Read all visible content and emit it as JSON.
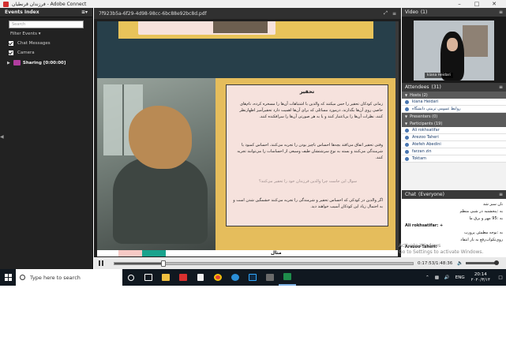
{
  "window": {
    "title": "فرزندان قرنطیان - Adobe Connect"
  },
  "events": {
    "title": "Events Index",
    "search_placeholder": "Search",
    "filter_label": "Filter Events",
    "checks": [
      "Chat Messages",
      "Camera"
    ],
    "sharing_label": "Sharing [0:00:00]"
  },
  "share": {
    "file_name": "7f923b5a-6f29-4d98-98cc-6bc88e92bc8d.pdf",
    "slide": {
      "title": "تحقیر",
      "paragraphs": [
        "زمانی کودکان تحقیر را حس میکنند که والدین با اشتباهات آن‌ها را مسخره کرده، نام‌های خاصی روی آن‌ها بگذارند، درمورد مسائلی که برای آن‌ها اهمیت دارد تحقیرآمیز اظهارنظر کنند، نظرات آن‌ها را بی‌اعتبار کنند و یا به هر صورتی آن‌ها را سرافکنده کنند.",
        "وقتی تحقیر اتفاق می‌افتد بچه‌ها احساس ناچیز بودن را تجربه می‌کنند، احساس کمبود یا شرمندگی می‌کنند و بسته به نوع سرشتشان طیف وسیعی از احساسات را می‌توانند تجربه کنند.",
        "سوال این جاست چرا والدین فرزندان خود را تحقیر می‌کنند؟",
        "اگر والدین در کودکی که احساس تحقیر و شرمندگی را تجربه می‌کنند خشمگین شدن است و به احتمال زیاد این کودکان آسیب خواهند دید."
      ],
      "next_word": "مثال"
    }
  },
  "playback": {
    "time": "0:17:53/1:48:36",
    "progress": 0.164
  },
  "video": {
    "title": "Video",
    "count": "(1)",
    "presenter_name": "kiana Heidari"
  },
  "attendees": {
    "title": "Attendees",
    "count": "(31)",
    "hosts_label": "Hosts (2)",
    "hosts": [
      "kiana Heidari",
      "روابط عمومی تربیتی دانشگاه"
    ],
    "presenters_label": "Presenters (0)",
    "participants_label": "Participants (19)",
    "participants": [
      "Ali rokhsatifar",
      "Arezoo Taheri",
      "Atefeh Abedini",
      "farzan zin",
      "Toktam"
    ]
  },
  "chat": {
    "title": "Chat",
    "scope": "(Everyone)",
    "messages": [
      "نان سبز شد",
      "به‌ :پنجشنبه در شبی منظم",
      "به‌ :95 مهر و برق ما",
      "Ali rokhsatifar: +",
      "به‌ :نوجه مطمئن پرورب",
      "روی‌تکواب‌رفع به بار انتقاد",
      "Arezoo Taheri:"
    ]
  },
  "watermark": [
    "Activate Windows",
    "Go to Settings to activate Windows."
  ],
  "taskbar": {
    "search_placeholder": "Type here to search",
    "language": "ENG",
    "time": "20:14",
    "date": "۲۰۲۰/۳/۱۴"
  },
  "colors": {
    "slide_gold": "#e5bd5c",
    "slide_card": "#f6e2dd",
    "slide_teal": "#273f4a",
    "host_blue": "#1a3c6b",
    "taskbar": "#101820"
  },
  "icons": {
    "window_controls": [
      "minimize-icon",
      "maximize-icon",
      "close-icon"
    ],
    "taskbar_apps": [
      "cortana-icon",
      "task-view-icon",
      "file-explorer-icon",
      "acrobat-icon",
      "file-icon",
      "chrome-icon",
      "edge-icon",
      "photoshop-icon",
      "film-icon",
      "connect-icon"
    ]
  }
}
